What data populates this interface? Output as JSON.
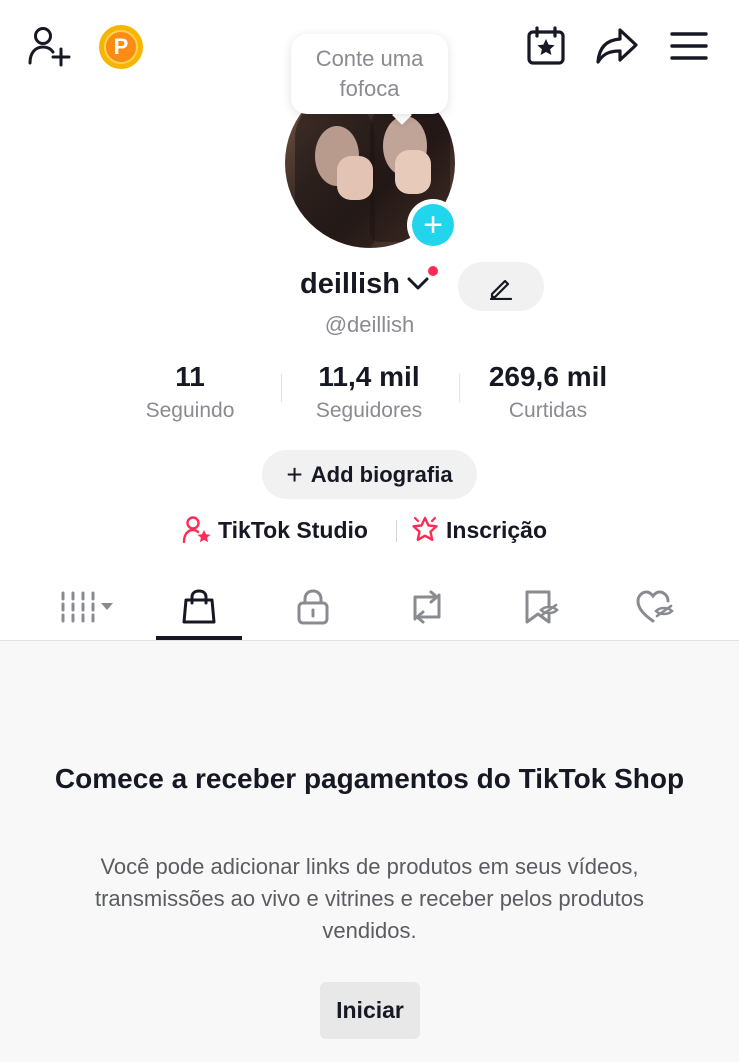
{
  "header": {
    "add_friend_icon": "person-plus-icon",
    "coin_icon": "promote-coin-icon",
    "coin_letter": "P",
    "calendar_icon": "calendar-star-icon",
    "share_icon": "share-arrow-icon",
    "menu_icon": "hamburger-menu-icon"
  },
  "tooltip": {
    "text": "Conte uma fofoca"
  },
  "profile": {
    "add_avatar_symbol": "+",
    "username": "deillish",
    "handle": "@deillish",
    "colors": {
      "accent_cyan": "#20d5ec",
      "notification_red": "#fe2c55"
    }
  },
  "stats": [
    {
      "value": "11",
      "label": "Seguindo"
    },
    {
      "value": "11,4 mil",
      "label": "Seguidores"
    },
    {
      "value": "269,6 mil",
      "label": "Curtidas"
    }
  ],
  "bio_button": {
    "symbol": "+",
    "label": "Add biografia"
  },
  "links": [
    {
      "label": "TikTok Studio",
      "icon": "person-star-icon",
      "color": "#fe2c55"
    },
    {
      "label": "Inscrição",
      "icon": "star-badge-icon",
      "color": "#fe2c55"
    }
  ],
  "tabs": [
    {
      "name": "videos",
      "icon": "grid-icon"
    },
    {
      "name": "shop",
      "icon": "shopping-bag-icon",
      "selected": true
    },
    {
      "name": "private",
      "icon": "lock-icon"
    },
    {
      "name": "reposts",
      "icon": "repost-icon"
    },
    {
      "name": "favorites",
      "icon": "bookmark-hidden-icon"
    },
    {
      "name": "liked",
      "icon": "heart-hidden-icon"
    }
  ],
  "shop_panel": {
    "title": "Comece a receber pagamentos do TikTok Shop",
    "description": "Você pode adicionar links de produtos em seus vídeos, transmissões ao vivo e vitrines e receber pelos produtos vendidos.",
    "button_label": "Iniciar"
  }
}
